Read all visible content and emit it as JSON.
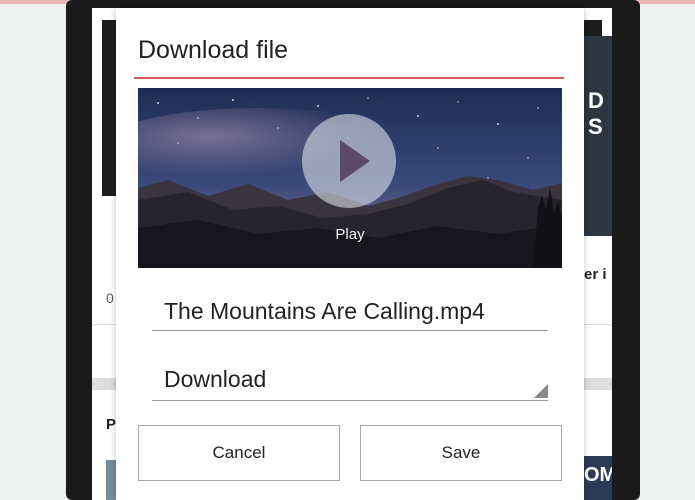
{
  "dialog": {
    "title": "Download file",
    "video": {
      "play_label": "Play",
      "play_icon": "play-icon"
    },
    "filename": {
      "value": "The Mountains Are Calling.mp4"
    },
    "directory": {
      "value": "Download",
      "icon": "dropdown-corner-icon"
    },
    "buttons": {
      "cancel": "Cancel",
      "save": "Save"
    }
  },
  "background": {
    "right_card_text": "D\nS",
    "right_snippet_text": "er i",
    "left_digit": "0",
    "left_heading": "P",
    "right_thumb_text": "OM"
  },
  "colors": {
    "accent": "#d65a5a",
    "phone_frame": "#1a1a1a",
    "page_bg": "#eef0f0"
  }
}
